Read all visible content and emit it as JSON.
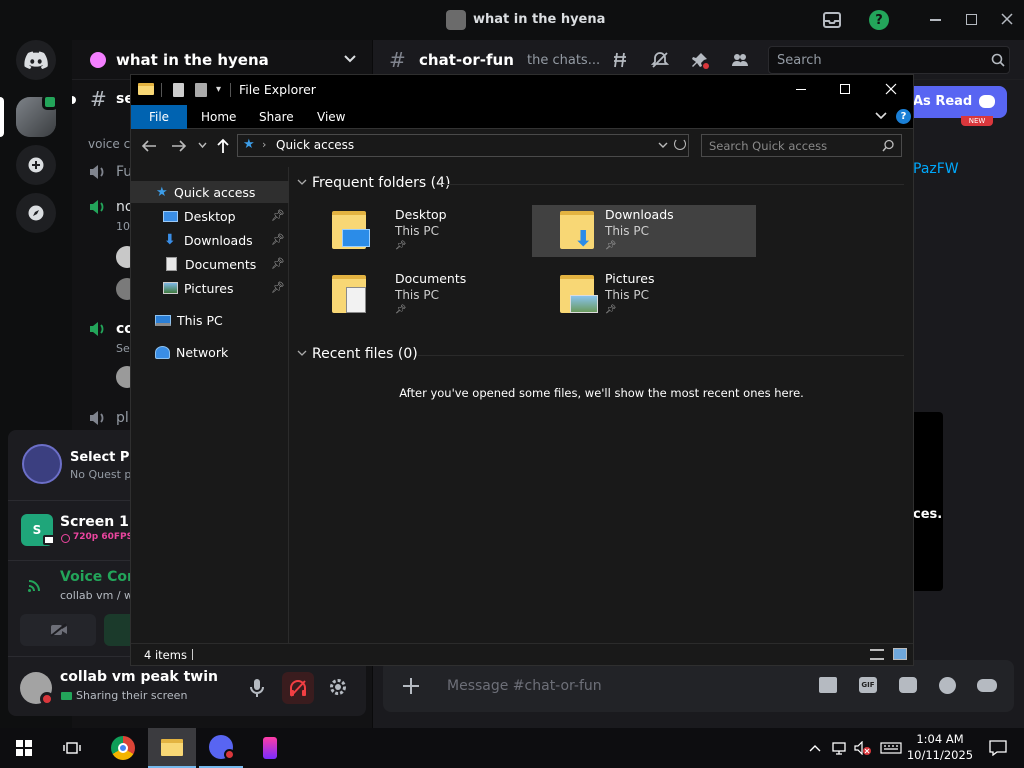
{
  "discord": {
    "window_title": "what in the hyena",
    "server_name": "what in the hyena",
    "channel_name": "chat-or-fun",
    "channel_topic": "the chats...",
    "search_placeholder": "Search",
    "channels_partial": [
      {
        "label": "se",
        "type": "text"
      },
      {
        "label": "voice c",
        "type": "category"
      },
      {
        "label": "Fu",
        "type": "voice"
      },
      {
        "label": "no",
        "type": "voice-active"
      },
      {
        "label": "10",
        "type": "sub"
      },
      {
        "label": "co",
        "type": "voice-active"
      },
      {
        "label": "Se",
        "type": "sub"
      },
      {
        "label": "pl",
        "type": "voice"
      }
    ],
    "mark_as_read": "As Read",
    "new_badge": "NEW",
    "link_fragment": "PazFW",
    "chat_fragment": "ces.",
    "quest": {
      "title": "Select Pla",
      "subtitle": "No Quest p"
    },
    "stream": {
      "title": "Screen 1",
      "quality": "720p 60FPS",
      "avatar_letter": "S"
    },
    "voice": {
      "status": "Voice Con",
      "channel": "collab vm / w"
    },
    "user": {
      "name": "collab vm peak twin",
      "status": "Sharing their screen"
    },
    "message_placeholder": "Message #chat-or-fun"
  },
  "explorer": {
    "title": "File Explorer",
    "tabs": [
      "File",
      "Home",
      "Share",
      "View"
    ],
    "address": "Quick access",
    "search_placeholder": "Search Quick access",
    "nav": {
      "quick_access": "Quick access",
      "pinned": [
        {
          "label": "Desktop",
          "icon": "desktop-icon"
        },
        {
          "label": "Downloads",
          "icon": "downloads-icon"
        },
        {
          "label": "Documents",
          "icon": "documents-icon"
        },
        {
          "label": "Pictures",
          "icon": "pictures-icon"
        }
      ],
      "this_pc": "This PC",
      "network": "Network"
    },
    "frequent_header": "Frequent folders (4)",
    "folders": [
      {
        "name": "Desktop",
        "location": "This PC",
        "icon": "desktop-folder-icon"
      },
      {
        "name": "Downloads",
        "location": "This PC",
        "icon": "downloads-folder-icon"
      },
      {
        "name": "Documents",
        "location": "This PC",
        "icon": "documents-folder-icon"
      },
      {
        "name": "Pictures",
        "location": "This PC",
        "icon": "pictures-folder-icon"
      }
    ],
    "recent_header": "Recent files (0)",
    "recent_empty": "After you've opened some files, we'll show the most recent ones here.",
    "status_items": "4 items",
    "selected_folder": "Downloads"
  },
  "taskbar": {
    "time": "1:04 AM",
    "date": "10/11/2025"
  },
  "colors": {
    "accent_blue": "#0063b1",
    "discord_blurple": "#5865f2",
    "voice_green": "#23a55a",
    "stream_green": "#1fa67a",
    "quality_pink": "#eb459f",
    "danger_red": "#da373c"
  }
}
